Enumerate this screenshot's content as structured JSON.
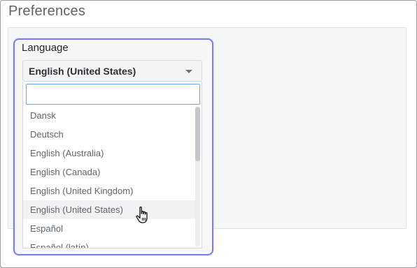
{
  "page": {
    "title": "Preferences"
  },
  "language": {
    "label": "Language",
    "selected": "English (United States)",
    "search_placeholder": "",
    "options": [
      "Dansk",
      "Deutsch",
      "English (Australia)",
      "English (Canada)",
      "English (United Kingdom)",
      "English (United States)",
      "Español",
      "Español (latín)"
    ],
    "hovered_index": 5,
    "caret_icon": "chevron-down-icon",
    "cursor_icon": "hand-pointer-icon"
  },
  "colors": {
    "focus_ring": "#7b7df0",
    "input_focus": "#62a8e8"
  }
}
